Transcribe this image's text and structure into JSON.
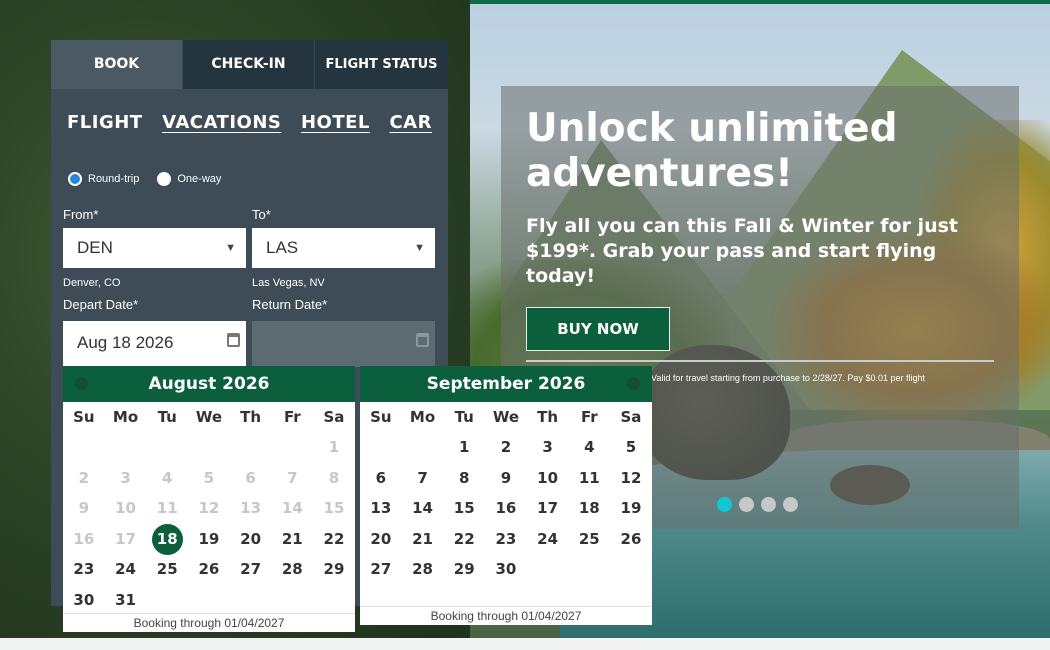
{
  "tabs": [
    "BOOK",
    "CHECK-IN",
    "FLIGHT STATUS"
  ],
  "modes": [
    "FLIGHT",
    "VACATIONS",
    "HOTEL",
    "CAR"
  ],
  "trip_type": {
    "round_trip": "Round-trip",
    "one_way": "One-way"
  },
  "from": {
    "label": "From*",
    "value": "DEN",
    "city": "Denver, CO"
  },
  "to": {
    "label": "To*",
    "value": "LAS",
    "city": "Las Vegas, NV"
  },
  "depart": {
    "label": "Depart Date*",
    "value": "Aug 18 2026"
  },
  "return": {
    "label": "Return Date*",
    "value": ""
  },
  "dow": [
    "Su",
    "Mo",
    "Tu",
    "We",
    "Th",
    "Fr",
    "Sa"
  ],
  "calendars": [
    {
      "title": "August 2026",
      "first_weekday": 6,
      "days": 31,
      "past_until": 17,
      "selected": 18,
      "footer": "Booking through 01/04/2027"
    },
    {
      "title": "September 2026",
      "first_weekday": 2,
      "days": 30,
      "past_until": 0,
      "selected": null,
      "footer": "Booking through 01/04/2027"
    }
  ],
  "hero": {
    "title": "Unlock unlimited adventures!",
    "subtitle": "Fly all you can this Fall & Winter for just $199*. Grab your pass and start flying today!",
    "button": "BUY NOW",
    "fine_print": "Valid for travel starting from purchase to 2/28/27. Pay $0.01 per flight",
    "active_slide": 1,
    "slides": 4
  },
  "colors": {
    "brand_green": "#0c5f3d",
    "panel": "#3d4c56",
    "dot_active": "#14c8d3"
  }
}
